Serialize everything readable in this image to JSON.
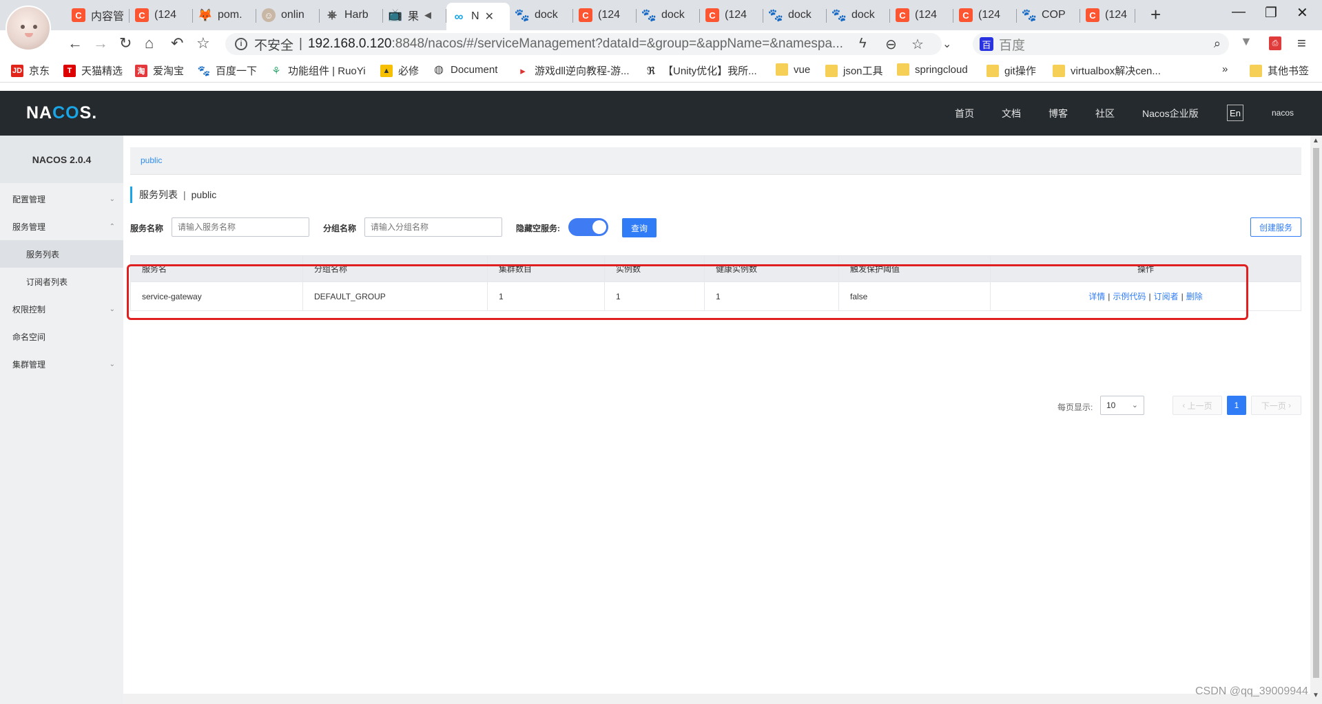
{
  "browser": {
    "tabs": [
      {
        "label": "内容管",
        "icon": "csdn-icon",
        "glyph": "C"
      },
      {
        "label": "(124",
        "icon": "csdn-icon",
        "glyph": "C"
      },
      {
        "label": "pom.",
        "icon": "gitlab-icon",
        "glyph": "🦊"
      },
      {
        "label": "onlin",
        "icon": "user-icon",
        "glyph": "☺"
      },
      {
        "label": "Harb",
        "icon": "harbor-icon",
        "glyph": "⎈"
      },
      {
        "label": "果",
        "icon": "tv-icon",
        "glyph": "📺"
      },
      {
        "label": "N",
        "icon": "nacos-icon",
        "glyph": "∞"
      },
      {
        "label": "dock",
        "icon": "paw-icon",
        "glyph": "🐾"
      },
      {
        "label": "(124",
        "icon": "csdn-icon",
        "glyph": "C"
      },
      {
        "label": "dock",
        "icon": "paw-icon",
        "glyph": "🐾"
      },
      {
        "label": "(124",
        "icon": "csdn-icon",
        "glyph": "C"
      },
      {
        "label": "dock",
        "icon": "paw-icon",
        "glyph": "🐾"
      },
      {
        "label": "dock",
        "icon": "paw-icon",
        "glyph": "🐾"
      },
      {
        "label": "(124",
        "icon": "csdn-icon",
        "glyph": "C"
      },
      {
        "label": "(124",
        "icon": "csdn-icon",
        "glyph": "C"
      },
      {
        "label": "COP",
        "icon": "paw-icon",
        "glyph": "🐾"
      },
      {
        "label": "(124",
        "icon": "csdn-icon",
        "glyph": "C"
      }
    ],
    "address": {
      "security_label": "不安全",
      "host": "192.168.0.120",
      "path": ":8848/nacos/#/serviceManagement?dataId=&group=&appName=&namespa..."
    },
    "search_engine": {
      "placeholder": "百度",
      "glyph": "百"
    },
    "bookmarks": [
      {
        "label": "京东",
        "icon": "jd-icon",
        "glyph": "JD"
      },
      {
        "label": "天猫精选",
        "icon": "tmall-icon",
        "glyph": "T"
      },
      {
        "label": "爱淘宝",
        "icon": "taobao-icon",
        "glyph": "淘"
      },
      {
        "label": "百度一下",
        "icon": "paw-icon",
        "glyph": "🐾"
      },
      {
        "label": "功能组件 | RuoYi",
        "icon": "ruoyi-icon",
        "glyph": "⚘"
      },
      {
        "label": "必修",
        "icon": "bixiu-icon",
        "glyph": "▲"
      },
      {
        "label": "Document",
        "icon": "globe-icon",
        "glyph": "◍"
      },
      {
        "label": "游戏dll逆向教程-游...",
        "icon": "game-icon",
        "glyph": "▸"
      },
      {
        "label": "【Unity优化】我所...",
        "icon": "unity-icon",
        "glyph": "ℜ"
      },
      {
        "label": "vue",
        "icon": "folder-icon",
        "glyph": ""
      },
      {
        "label": "json工具",
        "icon": "folder-icon",
        "glyph": ""
      },
      {
        "label": "springcloud",
        "icon": "folder-icon",
        "glyph": ""
      },
      {
        "label": "git操作",
        "icon": "folder-icon",
        "glyph": ""
      },
      {
        "label": "virtualbox解决cen...",
        "icon": "folder-icon",
        "glyph": ""
      }
    ],
    "bookmarks_overflow": "»",
    "other_bookmarks": "其他书签"
  },
  "nacos": {
    "logo": {
      "pre": "NA",
      "mid": "CO",
      "post": "S."
    },
    "nav": [
      "首页",
      "文档",
      "博客",
      "社区",
      "Nacos企业版"
    ],
    "lang_button": "En",
    "user": "nacos",
    "version": "NACOS 2.0.4",
    "sidebar": [
      {
        "label": "配置管理",
        "chevron": "⌄"
      },
      {
        "label": "服务管理",
        "chevron": "⌃"
      },
      {
        "label": "服务列表",
        "chevron": ""
      },
      {
        "label": "订阅者列表",
        "chevron": ""
      },
      {
        "label": "权限控制",
        "chevron": "⌄"
      },
      {
        "label": "命名空间",
        "chevron": ""
      },
      {
        "label": "集群管理",
        "chevron": "⌄"
      }
    ],
    "breadcrumb": "public",
    "page_title": {
      "main": "服务列表",
      "sep": "|",
      "namespace": "public"
    },
    "filters": {
      "service_name_label": "服务名称",
      "service_name_placeholder": "请输入服务名称",
      "group_name_label": "分组名称",
      "group_name_placeholder": "请输入分组名称",
      "hide_empty_label": "隐藏空服务:",
      "hide_empty_on": true,
      "query_button": "查询",
      "create_button": "创建服务"
    },
    "table": {
      "columns": [
        "服务名",
        "分组名称",
        "集群数目",
        "实例数",
        "健康实例数",
        "触发保护阈值",
        "操作"
      ],
      "rows": [
        {
          "service": "service-gateway",
          "group": "DEFAULT_GROUP",
          "clusters": "1",
          "instances": "1",
          "healthy": "1",
          "threshold": "false",
          "ops": [
            "详情",
            "示例代码",
            "订阅者",
            "删除"
          ]
        }
      ]
    },
    "pagination": {
      "page_size_label": "每页显示:",
      "page_size": "10",
      "prev": "上一页",
      "next": "下一页",
      "current": "1"
    }
  },
  "watermark": "CSDN @qq_39009944",
  "colors": {
    "highlight": "#e02020",
    "primary": "#2f7cf6",
    "nav_bg": "#252a2f"
  }
}
